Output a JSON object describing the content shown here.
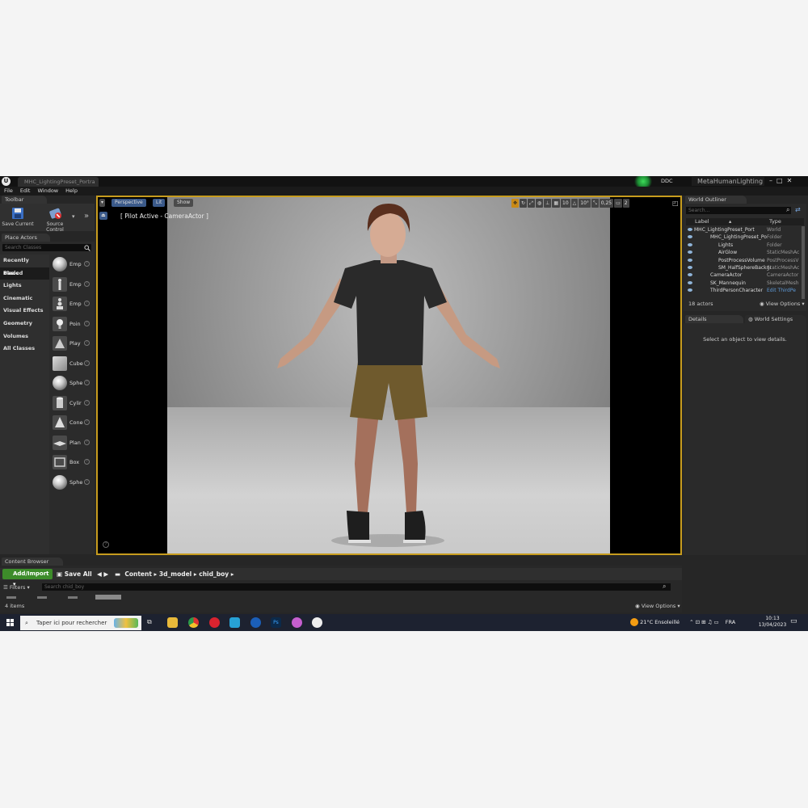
{
  "window": {
    "doc_tab": "MHC_LightingPreset_Portra",
    "ddc": "DDC",
    "project_name": "MetaHumanLighting"
  },
  "menu": [
    "File",
    "Edit",
    "Window",
    "Help"
  ],
  "toolbar": {
    "tab": "Toolbar",
    "save_current": "Save Current",
    "source_control": "Source Control"
  },
  "place_actors": {
    "tab": "Place Actors",
    "search_placeholder": "Search Classes",
    "categories": [
      "Recently Placed",
      "Basic",
      "Lights",
      "Cinematic",
      "Visual Effects",
      "Geometry",
      "Volumes",
      "All Classes"
    ],
    "active_category": "Basic",
    "items": [
      {
        "label": "Emp",
        "icon": "sphere-icon"
      },
      {
        "label": "Emp",
        "icon": "character-icon"
      },
      {
        "label": "Emp",
        "icon": "pawn-icon"
      },
      {
        "label": "Poin",
        "icon": "point-light-icon"
      },
      {
        "label": "Play",
        "icon": "player-start-icon"
      },
      {
        "label": "Cube",
        "icon": "cube-icon"
      },
      {
        "label": "Sphe",
        "icon": "sphere-icon"
      },
      {
        "label": "Cylir",
        "icon": "cylinder-icon"
      },
      {
        "label": "Cone",
        "icon": "cone-icon"
      },
      {
        "label": "Plan",
        "icon": "plane-icon"
      },
      {
        "label": "Box",
        "icon": "box-trigger-icon"
      },
      {
        "label": "Sphe",
        "icon": "sphere-trigger-icon"
      }
    ]
  },
  "viewport": {
    "perspective": "Perspective",
    "lit": "Lit",
    "show": "Show",
    "pilot": "[ Pilot Active - CameraActor ]",
    "grid_snap": "10",
    "rot_snap": "10°",
    "scale_snap": "0,25",
    "camera_speed": "2"
  },
  "outliner": {
    "tab": "World Outliner",
    "search_placeholder": "Search...",
    "col_label": "Label",
    "col_type": "Type",
    "rows": [
      {
        "name": "MHC_LightingPreset_Port",
        "type": "World",
        "indent": 10
      },
      {
        "name": "MHC_LightingPreset_Po",
        "type": "Folder",
        "indent": 30
      },
      {
        "name": "Lights",
        "type": "Folder",
        "indent": 40
      },
      {
        "name": "AirGlow",
        "type": "StaticMeshAc",
        "indent": 40
      },
      {
        "name": "PostProcessVolume",
        "type": "PostProcessV",
        "indent": 40
      },
      {
        "name": "SM_HalfSphereBackgr",
        "type": "StaticMeshAc",
        "indent": 40
      },
      {
        "name": "CameraActor",
        "type": "CameraActor",
        "indent": 30
      },
      {
        "name": "SK_Mannequin",
        "type": "SkeletalMesh",
        "indent": 30
      },
      {
        "name": "ThirdPersonCharacter",
        "type": "Edit ThirdPe",
        "indent": 30,
        "link": true
      }
    ],
    "count": "18 actors",
    "view_options": "View Options"
  },
  "details": {
    "tab_details": "Details",
    "tab_world": "World Settings",
    "message": "Select an object to view details."
  },
  "content_browser": {
    "tab": "Content Browser",
    "add_import": "Add/Import",
    "save_all": "Save All",
    "path": [
      "Content",
      "3d_model",
      "chid_boy"
    ],
    "filters": "Filters",
    "search_placeholder": "Search chid_boy",
    "items_count": "4 items",
    "view_options": "View Options"
  },
  "taskbar": {
    "search_placeholder": "Taper ici pour rechercher",
    "weather": "21°C  Ensoleillé",
    "lang": "FRA",
    "time": "10:13",
    "date": "13/04/2023"
  },
  "colors": {
    "viewport_border": "#c79c1e",
    "add_import": "#3d8c2a",
    "accent_blue": "#3b5a8a"
  }
}
